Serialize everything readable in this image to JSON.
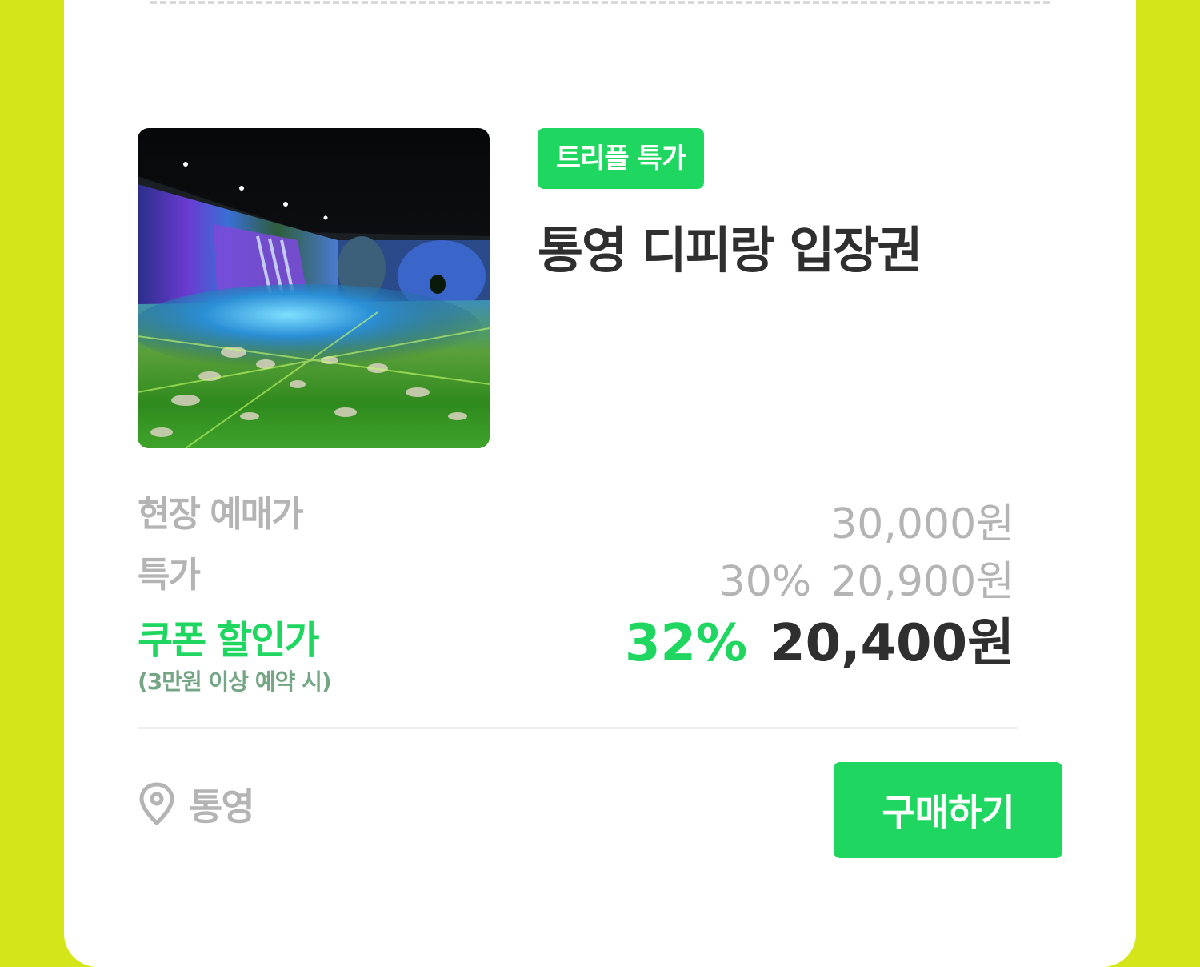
{
  "product": {
    "badge": "트리플 특가",
    "title": "통영 디피랑 입장권",
    "image_alt": "digital-art-garden-photo"
  },
  "pricing": {
    "onsite_label": "현장 예매가",
    "onsite_price": "30,000원",
    "special_label": "특가",
    "special_percent": "30%",
    "special_price": "20,900원",
    "coupon_label": "쿠폰 할인가",
    "coupon_note": "(3만원 이상 예약 시)",
    "coupon_percent": "32%",
    "coupon_price": "20,400원"
  },
  "footer": {
    "location_icon": "location-pin-icon",
    "location": "통영",
    "buy_label": "구매하기"
  },
  "colors": {
    "background": "#d4e61a",
    "card": "#ffffff",
    "accent": "#1fd660",
    "muted": "#b4b4b4",
    "text": "#2f2f2f",
    "note": "#74a584"
  }
}
